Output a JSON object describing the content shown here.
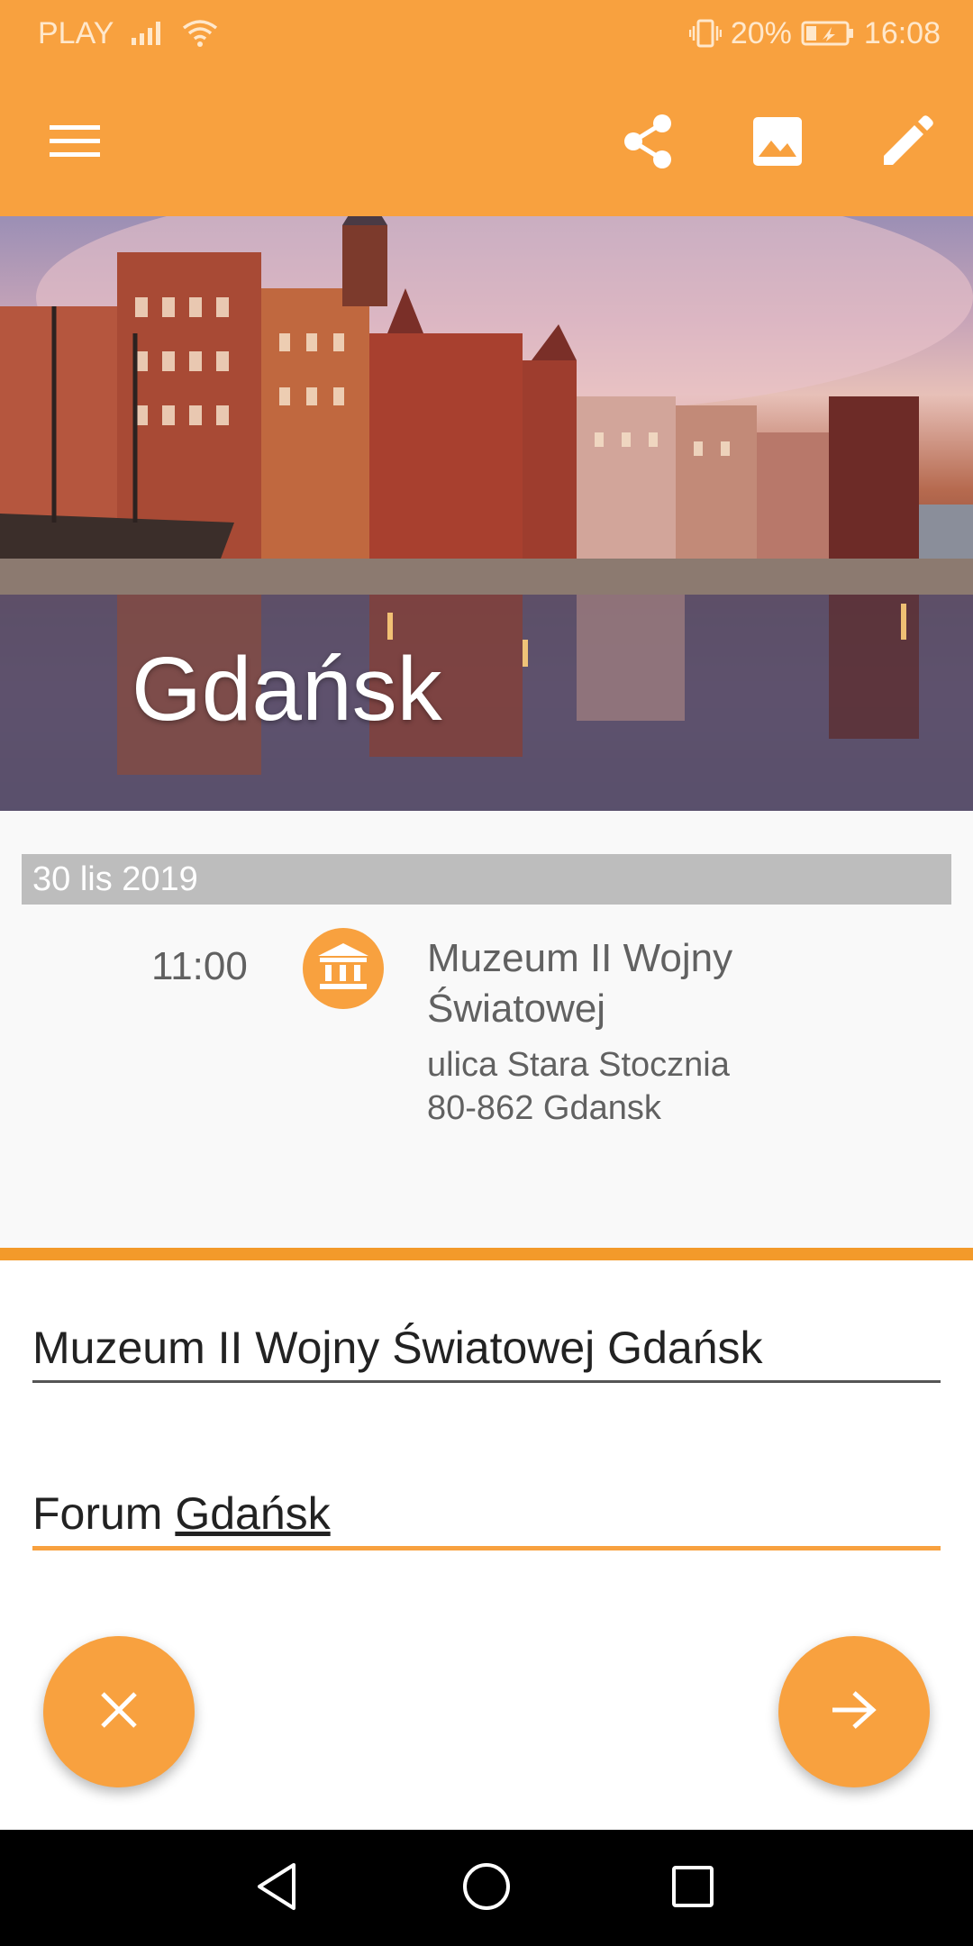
{
  "status_bar": {
    "carrier": "PLAY",
    "battery_percent": "20%",
    "time": "16:08",
    "icons": [
      "signal-icon",
      "wifi-icon",
      "vibrate-icon",
      "battery-icon"
    ]
  },
  "toolbar": {
    "icons": [
      "menu-icon",
      "share-icon",
      "image-icon",
      "edit-icon"
    ]
  },
  "hero": {
    "title": "Gdańsk"
  },
  "itinerary": {
    "date": "30 lis 2019",
    "event": {
      "time": "11:00",
      "icon": "museum-icon",
      "name_line1": "Muzeum II Wojny",
      "name_line2": "Światowej",
      "address_line1": "ulica Stara Stocznia",
      "address_line2": "80-862 Gdansk"
    }
  },
  "search": {
    "field1_value": "Muzeum II Wojny Światowej Gdańsk",
    "field2_prefix": "Forum ",
    "field2_underlined": "Gdańsk"
  },
  "fabs": {
    "close_icon": "close-icon",
    "next_icon": "arrow-right-icon"
  },
  "colors": {
    "accent": "#F8A13F",
    "divider": "#F39A2A",
    "date_bar": "#BDBDBD"
  }
}
